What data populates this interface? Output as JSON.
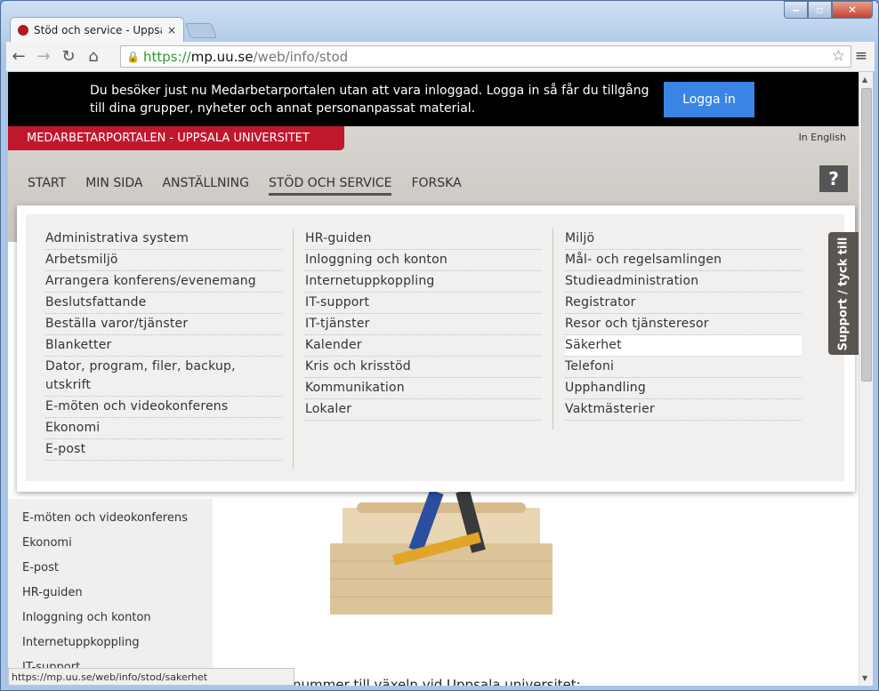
{
  "browser": {
    "tab_title": "Stöd och service - Uppsala",
    "tab_close": "×",
    "url_scheme": "https://",
    "url_host": "mp.uu.se",
    "url_path": "/web/info/stod",
    "status_url": "https://mp.uu.se/web/info/stod/sakerhet"
  },
  "banner": {
    "message": "Du besöker just nu Medarbetarportalen utan att vara inloggad. Logga in så får du tillgång till dina grupper, nyheter och annat personanpassat material.",
    "login_label": "Logga in"
  },
  "header": {
    "brand": "MEDARBETARPORTALEN - UPPSALA UNIVERSITET",
    "english": "In English",
    "help": "?",
    "nav": [
      "START",
      "MIN SIDA",
      "ANSTÄLLNING",
      "STÖD OCH SERVICE",
      "FORSKA"
    ]
  },
  "megamenu": {
    "col1": [
      "Administrativa system",
      "Arbetsmiljö",
      "Arrangera konferens/evenemang",
      "Beslutsfattande",
      "Beställa varor/tjänster",
      "Blanketter",
      "Dator, program, filer, backup, utskrift",
      "E-möten och videokonferens",
      "Ekonomi",
      "E-post"
    ],
    "col2": [
      "HR-guiden",
      "Inloggning och konton",
      "Internetuppkoppling",
      "IT-support",
      "IT-tjänster",
      "Kalender",
      "Kris och krisstöd",
      "Kommunikation",
      "Lokaler"
    ],
    "col3": [
      "Miljö",
      "Mål- och regelsamlingen",
      "Studieadministration",
      "Registrator",
      "Resor och tjänsteresor",
      "Säkerhet",
      "Telefoni",
      "Upphandling",
      "Vaktmästerier"
    ]
  },
  "sidebar": [
    "E-möten och videokonferens",
    "Ekonomi",
    "E-post",
    "HR-guiden",
    "Inloggning och konton",
    "Internetuppkoppling",
    "IT-support"
  ],
  "support_tab": "Support / tyck till",
  "bottom_text": "nummer till växeln vid Uppsala universitet:",
  "colors": {
    "brand_red": "#c1172d",
    "login_blue": "#3a84e6",
    "banner_bg": "#000000"
  }
}
